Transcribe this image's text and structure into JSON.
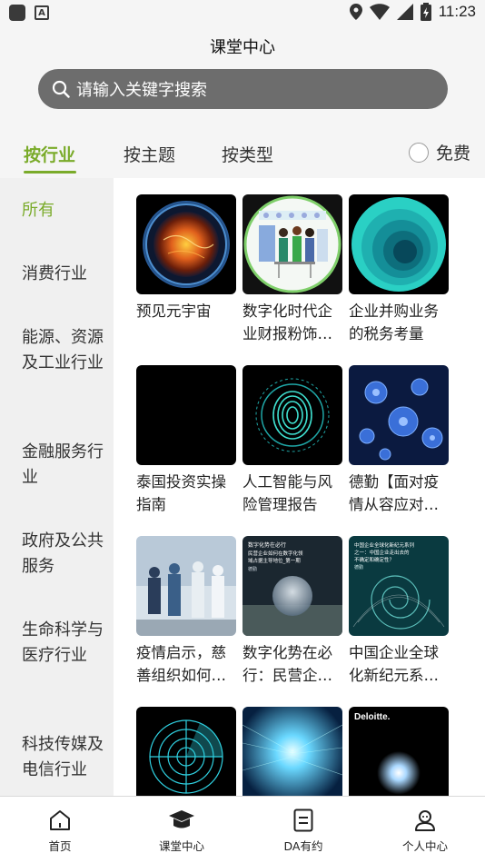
{
  "status_bar": {
    "time": "11:23"
  },
  "header": {
    "title": "课堂中心"
  },
  "search": {
    "placeholder": "请输入关键字搜索"
  },
  "tabs": [
    {
      "label": "按行业",
      "active": true
    },
    {
      "label": "按主题",
      "active": false
    },
    {
      "label": "按类型",
      "active": false
    }
  ],
  "free_filter": {
    "label": "免费",
    "checked": false
  },
  "sidebar": {
    "items": [
      {
        "label": "所有",
        "active": true
      },
      {
        "label": "消费行业"
      },
      {
        "label": "能源、资源及工业行业"
      },
      {
        "label": "金融服务行业"
      },
      {
        "label": "政府及公共服务"
      },
      {
        "label": "生命科学与医疗行业"
      },
      {
        "label": "科技传媒及电信行业"
      }
    ]
  },
  "courses": [
    {
      "title": "预见元宇宙",
      "thumb": "planet-globe"
    },
    {
      "title": "数字化时代企业财报粉饰…",
      "thumb": "team-illustration"
    },
    {
      "title": "企业并购业务的税务考量",
      "thumb": "teal-spiral"
    },
    {
      "title": "泰国投资实操指南",
      "thumb": "black"
    },
    {
      "title": "人工智能与风险管理报告",
      "thumb": "fingerprint"
    },
    {
      "title": "德勤【面对疫情从容应对…",
      "thumb": "virus"
    },
    {
      "title": "疫情启示，慈善组织如何…",
      "thumb": "medical-team"
    },
    {
      "title": "数字化势在必行：民营企…",
      "thumb": "glass-sphere",
      "thumb_text": [
        "数字化势在必行",
        "民营企业如何在数字化领",
        "域占据主导地位_第一期",
        "德勤"
      ]
    },
    {
      "title": "中国企业全球化新纪元系…",
      "thumb": "wave-swirl",
      "thumb_text": [
        "中国企业全球化新纪元系列",
        "之一：中国企业走出去的",
        "不确定和确定性？",
        "德勤"
      ]
    },
    {
      "title": "",
      "thumb": "radar"
    },
    {
      "title": "",
      "thumb": "data-tunnel"
    },
    {
      "title": "",
      "thumb": "deloitte-burst",
      "thumb_text": [
        "Deloitte."
      ]
    }
  ],
  "bottom_nav": [
    {
      "label": "首页",
      "icon": "home-icon"
    },
    {
      "label": "课堂中心",
      "icon": "graduation-cap-icon",
      "active": true
    },
    {
      "label": "DA有约",
      "icon": "document-icon"
    },
    {
      "label": "个人中心",
      "icon": "person-icon"
    }
  ],
  "colors": {
    "accent": "#7aab2a",
    "search_bg": "#6d6d6d",
    "sidebar_bg": "#f0f0f0"
  }
}
